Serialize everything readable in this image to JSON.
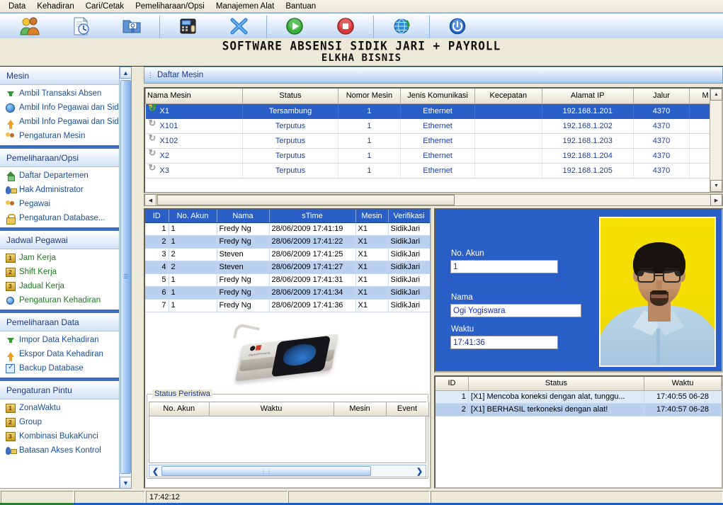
{
  "menu": {
    "items": [
      "Data",
      "Kehadiran",
      "Cari/Cetak",
      "Pemeliharaan/Opsi",
      "Manajemen Alat",
      "Bantuan"
    ]
  },
  "toolbar": {
    "buttons": [
      {
        "label": "Pegawai",
        "icon": "two-people-icon"
      },
      {
        "label": "Jejak",
        "icon": "document-clock-icon"
      },
      {
        "label": "Laporan",
        "icon": "folder-report-icon"
      },
      {
        "label": "Alat",
        "icon": "device-icon"
      },
      {
        "label": "Hapus Alat",
        "icon": "blue-x-icon"
      },
      {
        "label": "Sambung",
        "icon": "green-play-icon"
      },
      {
        "label": "Putuskan",
        "icon": "red-stop-icon"
      },
      {
        "label": "Perbaharui",
        "icon": "globe-refresh-icon"
      },
      {
        "label": "Exit system",
        "icon": "power-icon"
      }
    ]
  },
  "banner": {
    "line1": "SOFTWARE ABSENSI SIDIK JARI + PAYROLL",
    "line2": "ELKHA BISNIS"
  },
  "sidebar": {
    "groups": [
      {
        "title": "Mesin",
        "items": [
          {
            "label": "Ambil Transaksi Absen",
            "icon": "green-down-arrow-icon"
          },
          {
            "label": "Ambil Info Pegawai dan SidikJari",
            "icon": "blue-download-circle-icon"
          },
          {
            "label": "Ambil Info Pegawai dan SidikJari",
            "icon": "orange-up-arrow-icon"
          },
          {
            "label": "Pengaturan Mesin",
            "icon": "settings-nodes-icon"
          }
        ]
      },
      {
        "title": "Pemeliharaan/Opsi",
        "items": [
          {
            "label": "Daftar Departemen",
            "icon": "house-icon"
          },
          {
            "label": "Hak Administrator",
            "icon": "admin-key-icon"
          },
          {
            "label": "Pegawai",
            "icon": "two-people-icon"
          },
          {
            "label": "Pengaturan Database...",
            "icon": "lock-icon"
          }
        ]
      },
      {
        "title": "Jadwal Pegawai",
        "items": [
          {
            "label": "Jam Kerja",
            "icon": "number-1-icon"
          },
          {
            "label": "Shift Kerja",
            "icon": "number-2-icon"
          },
          {
            "label": "Jadual Kerja",
            "icon": "number-3-icon"
          },
          {
            "label": "Pengaturan Kehadiran",
            "icon": "blue-sphere-icon"
          }
        ]
      },
      {
        "title": "Pemeliharaan Data",
        "items": [
          {
            "label": "Impor Data Kehadiran",
            "icon": "green-down-arrow-icon"
          },
          {
            "label": "Ekspor Data Kehadiran",
            "icon": "orange-up-arrow-icon"
          },
          {
            "label": "Backup Database",
            "icon": "backup-doc-icon"
          }
        ]
      },
      {
        "title": "Pengaturan Pintu",
        "items": [
          {
            "label": "ZonaWaktu",
            "icon": "number-1-icon"
          },
          {
            "label": "Group",
            "icon": "number-2-icon"
          },
          {
            "label": "Kombinasi BukaKunci",
            "icon": "number-3-icon"
          },
          {
            "label": "Batasan Akses Kontrol",
            "icon": "admin-key-icon"
          }
        ]
      }
    ]
  },
  "content": {
    "tab_label": "Daftar Mesin",
    "machine_table": {
      "columns": [
        "Nama Mesin",
        "Status",
        "Nomor Mesin",
        "Jenis Komunikasi",
        "Kecepatan",
        "Alamat IP",
        "Jalur",
        "M"
      ],
      "rows": [
        {
          "nama": "X1",
          "status": "Tersambung",
          "nomor": "1",
          "komunikasi": "Ethernet",
          "kecepatan": "",
          "ip": "192.168.1.201",
          "jalur": "4370",
          "m": "",
          "selected": true
        },
        {
          "nama": "X101",
          "status": "Terputus",
          "nomor": "1",
          "komunikasi": "Ethernet",
          "kecepatan": "",
          "ip": "192.168.1.202",
          "jalur": "4370",
          "m": "",
          "selected": false
        },
        {
          "nama": "X102",
          "status": "Terputus",
          "nomor": "1",
          "komunikasi": "Ethernet",
          "kecepatan": "",
          "ip": "192.168.1.203",
          "jalur": "4370",
          "m": "",
          "selected": false
        },
        {
          "nama": "X2",
          "status": "Terputus",
          "nomor": "1",
          "komunikasi": "Ethernet",
          "kecepatan": "",
          "ip": "192.168.1.204",
          "jalur": "4370",
          "m": "",
          "selected": false
        },
        {
          "nama": "X3",
          "status": "Terputus",
          "nomor": "1",
          "komunikasi": "Ethernet",
          "kecepatan": "",
          "ip": "192.168.1.205",
          "jalur": "4370",
          "m": "",
          "selected": false
        }
      ]
    },
    "log_table": {
      "columns": [
        "ID",
        "No. Akun",
        "Nama",
        "sTime",
        "Mesin",
        "Verifikasi"
      ],
      "rows": [
        {
          "id": "1",
          "akun": "1",
          "nama": "Fredy Ng",
          "stime": "28/06/2009 17:41:19",
          "mesin": "X1",
          "verifikasi": "SidikJari"
        },
        {
          "id": "2",
          "akun": "1",
          "nama": "Fredy Ng",
          "stime": "28/06/2009 17:41:22",
          "mesin": "X1",
          "verifikasi": "SidikJari"
        },
        {
          "id": "3",
          "akun": "2",
          "nama": "Steven",
          "stime": "28/06/2009 17:41:25",
          "mesin": "X1",
          "verifikasi": "SidikJari"
        },
        {
          "id": "4",
          "akun": "2",
          "nama": "Steven",
          "stime": "28/06/2009 17:41:27",
          "mesin": "X1",
          "verifikasi": "SidikJari"
        },
        {
          "id": "5",
          "akun": "1",
          "nama": "Fredy Ng",
          "stime": "28/06/2009 17:41:31",
          "mesin": "X1",
          "verifikasi": "SidikJari"
        },
        {
          "id": "6",
          "akun": "1",
          "nama": "Fredy Ng",
          "stime": "28/06/2009 17:41:34",
          "mesin": "X1",
          "verifikasi": "SidikJari"
        },
        {
          "id": "7",
          "akun": "1",
          "nama": "Fredy Ng",
          "stime": "28/06/2009 17:41:36",
          "mesin": "X1",
          "verifikasi": "SidikJari"
        }
      ]
    },
    "peristiwa": {
      "title": "Status Peristiwa",
      "columns": [
        "No. Akun",
        "Waktu",
        "Mesin",
        "Event"
      ],
      "rows": []
    }
  },
  "employee_card": {
    "no_akun_label": "No. Akun",
    "no_akun_value": "1",
    "nama_label": "Nama",
    "nama_value": "Ogi Yogiswara",
    "waktu_label": "Waktu",
    "waktu_value": "17:41:36"
  },
  "status_log": {
    "columns": [
      "ID",
      "Status",
      "Waktu"
    ],
    "rows": [
      {
        "id": "1",
        "status": "[X1] Mencoba koneksi dengan alat, tunggu...",
        "waktu": "17:40:55 06-28"
      },
      {
        "id": "2",
        "status": "[X1] BERHASIL terkoneksi dengan alat!",
        "waktu": "17:40:57 06-28"
      }
    ]
  },
  "statusbar": {
    "panel1": "",
    "panel2": "",
    "panel3": "17:42:12",
    "panel4": "",
    "panel5": ""
  },
  "colors": {
    "accent_blue": "#2a5fc8",
    "sidebar_link": "#1a4fa0",
    "sidebar_link_green": "#1f7a1f",
    "banner_bg": "#ece9d8",
    "photo_bg": "#f2dd00"
  }
}
